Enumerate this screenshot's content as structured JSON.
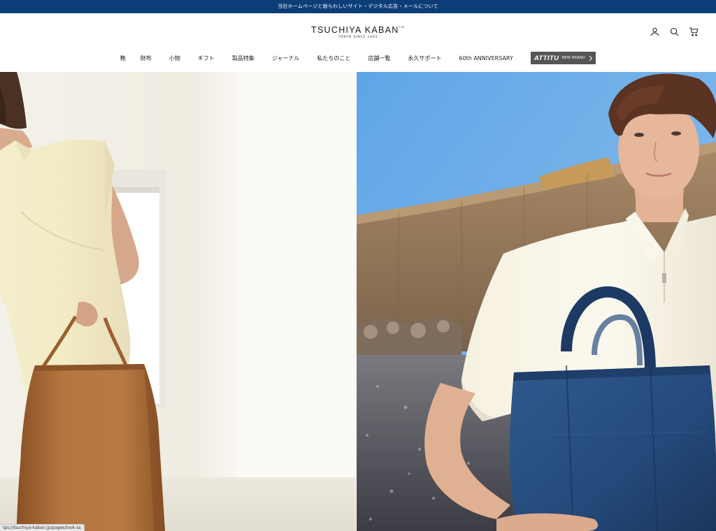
{
  "announcement": {
    "text": "当社ホームページと紛らわしいサイト・デジタル広告・メールについて"
  },
  "logo": {
    "name": "TSUCHIYA KABAN",
    "trademark": "TM",
    "tagline": "TOKYO  SINCE 1965"
  },
  "header_icons": [
    "account-icon",
    "search-icon",
    "cart-icon"
  ],
  "nav": {
    "items": [
      {
        "label": "鞄"
      },
      {
        "label": "財布"
      },
      {
        "label": "小物"
      },
      {
        "label": "ギフト"
      },
      {
        "label": "製品特集"
      },
      {
        "label": "ジャーナル"
      },
      {
        "label": "私たちのこと"
      },
      {
        "label": "店舗一覧"
      },
      {
        "label": "永久サポート"
      },
      {
        "label": "60th ANNIVERSARY"
      }
    ],
    "brand": {
      "name": "ATTITU",
      "tag": "NEW BRAND"
    }
  },
  "status_bar": {
    "url": "tps://tsuchiya-kaban.jp/pages/look-ss"
  },
  "colors": {
    "announcement_bg": "#0d3d78",
    "brand_badge_bg": "#555555"
  }
}
